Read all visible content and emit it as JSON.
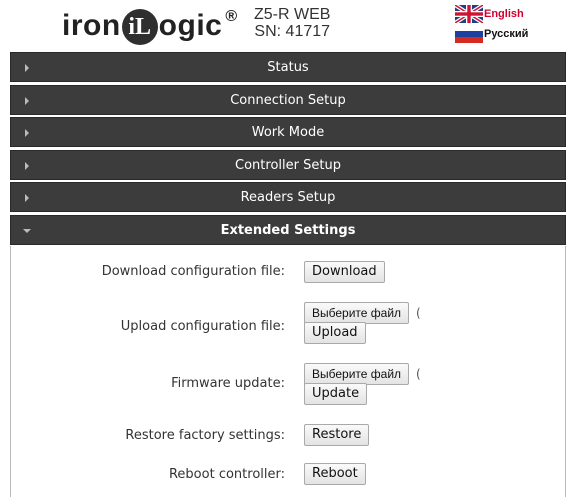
{
  "header": {
    "logo": {
      "text_left": "iron",
      "text_mark": "iL",
      "text_right": "ogic",
      "reg": "®"
    },
    "device": {
      "model": "Z5-R WEB",
      "serial": "SN: 41717"
    },
    "languages": [
      {
        "label": "English",
        "flag": "uk-flag-icon"
      },
      {
        "label": "Русский",
        "flag": "ru-flag-icon"
      }
    ]
  },
  "sections": [
    {
      "label": "Status",
      "expanded": false
    },
    {
      "label": "Connection Setup",
      "expanded": false
    },
    {
      "label": "Work Mode",
      "expanded": false
    },
    {
      "label": "Controller Setup",
      "expanded": false
    },
    {
      "label": "Readers Setup",
      "expanded": false
    },
    {
      "label": "Extended Settings",
      "expanded": true
    }
  ],
  "extended": {
    "download": {
      "label": "Download configuration file:",
      "button": "Download"
    },
    "upload": {
      "label": "Upload configuration file:",
      "file_button": "Выберите файл",
      "file_tail": "(",
      "button": "Upload"
    },
    "firmware": {
      "label": "Firmware update:",
      "file_button": "Выберите файл",
      "file_tail": "(",
      "button": "Update"
    },
    "restore": {
      "label": "Restore factory settings:",
      "button": "Restore"
    },
    "reboot": {
      "label": "Reboot controller:",
      "button": "Reboot"
    }
  },
  "colors": {
    "bar_bg": "#3c3c3c",
    "bar_text": "#ffffff",
    "english_link": "#d1002e"
  }
}
